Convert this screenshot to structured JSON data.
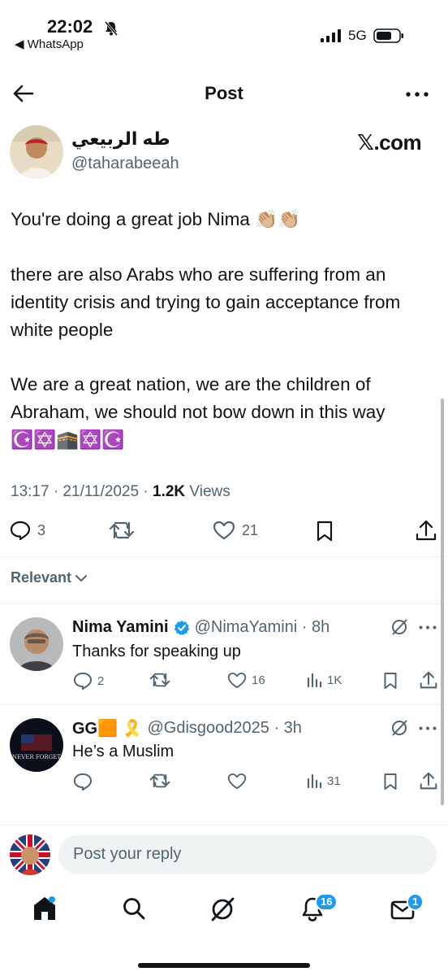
{
  "status_bar": {
    "time": "22:02",
    "back_app": "◀ WhatsApp",
    "network": "5G"
  },
  "header": {
    "title": "Post"
  },
  "post": {
    "author_name": "طه الربيعي",
    "author_handle": "@taharabeeah",
    "source": "𝕏.com",
    "paragraphs": [
      "You're doing a great job Nima 👏🏼👏🏼",
      "there are also Arabs who are suffering from an identity crisis and trying to gain acceptance from white people",
      "We are a great nation, we are the children of Abraham, we should not bow down in this way",
      "☪️✡️🕋✡️☪️"
    ],
    "timestamp": "13:17 · 21/11/2025 · ",
    "views_count": "1.2K",
    "views_label": " Views",
    "replies": "3",
    "likes": "21"
  },
  "sort": {
    "label": "Relevant"
  },
  "replies": [
    {
      "name": "Nima Yamini",
      "handle": "@NimaYamini · 8h",
      "text": "Thanks for speaking up",
      "reply_count": "2",
      "retweet_count": "",
      "like_count": "16",
      "views": "1K"
    },
    {
      "name": "GG🟧 🎗️",
      "handle": "@Gdisgood2025 · 3h",
      "text": "He’s a Muslim",
      "reply_count": "",
      "retweet_count": "",
      "like_count": "",
      "views": "31"
    }
  ],
  "composer": {
    "placeholder": "Post your reply"
  },
  "tab_bar": {
    "notifications_badge": "16",
    "messages_badge": "1"
  },
  "colors": {
    "accent": "#1d9bf0",
    "text": "#0f1419",
    "muted": "#536471"
  }
}
